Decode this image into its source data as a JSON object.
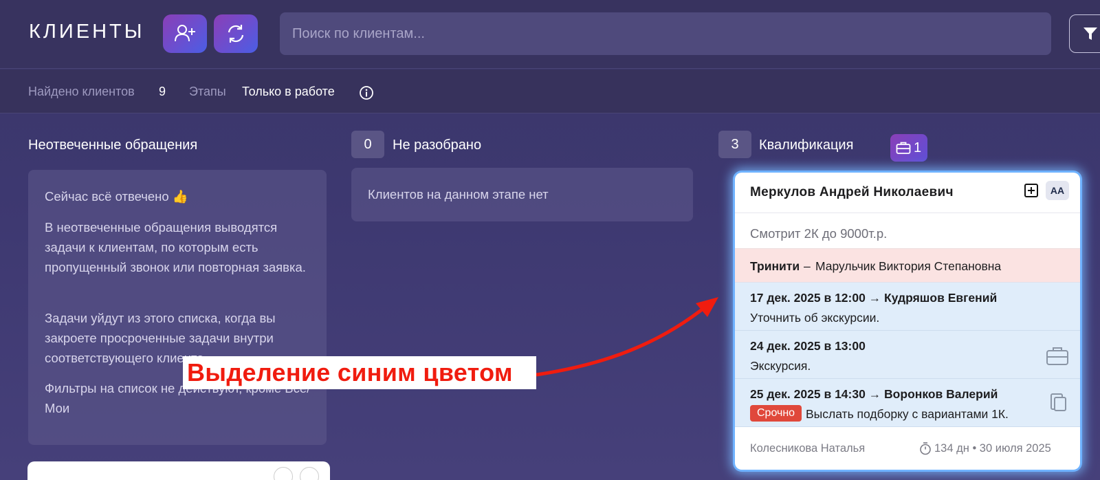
{
  "header": {
    "title": "КЛИЕНТЫ",
    "search_placeholder": "Поиск по клиентам..."
  },
  "stats": {
    "found_label": "Найдено клиентов",
    "found_count": "9",
    "stages_label": "Этапы",
    "stages_value": "Только в работе"
  },
  "unanswered": {
    "title": "Неотвеченные обращения",
    "p1": "Сейчас всё отвечено 👍",
    "p2": "В неотвеченные обращения выводятся задачи к клиентам, по которым есть пропущенный звонок или повторная заявка.",
    "p3": "Задачи уйдут из этого списка, когда вы закроете просроченные задачи внутри соответствующего клиента.",
    "p4": "Фильтры на список не действуют, кроме Все/Мои"
  },
  "unsorted": {
    "count": "0",
    "title": "Не разобрано",
    "empty": "Клиентов на данном этапе нет"
  },
  "qualification": {
    "count": "3",
    "title": "Квалификация",
    "badge_count": "1",
    "card": {
      "name": "Меркулов Андрей Николаевич",
      "aa_label": "AA",
      "description": "Смотрит 2К до 9000т.р.",
      "agency": "Тринити",
      "agency_sep": "–",
      "agency_person": "Марульчик Виктория Степановна",
      "tasks": [
        {
          "title": "17 дек. 2025 в 12:00 → Кудряшов Евгений",
          "text": "Уточнить об экскурсии."
        },
        {
          "title": "24 дек. 2025 в 13:00",
          "text": "Экскурсия."
        },
        {
          "title": "25 дек. 2025 в 14:30 → Воронков Валерий",
          "urgent_label": "Срочно",
          "text": "Выслать подборку с вариантами 1К."
        }
      ],
      "footer": {
        "manager": "Колесникова Наталья",
        "age": "134 дн • 30 июля 2025"
      }
    }
  },
  "annotation": {
    "text": "Выделение синим цветом"
  },
  "colors": {
    "background": "#3d3870",
    "accent_gradient_start": "#8a3fb7",
    "accent_gradient_end": "#4a5ee5",
    "highlight": "#6fb2ff",
    "task_bg": "#e0edfa",
    "agency_bg": "#fbe3e2",
    "urgent": "#e0483b",
    "annotation_red": "#f01c0f"
  }
}
